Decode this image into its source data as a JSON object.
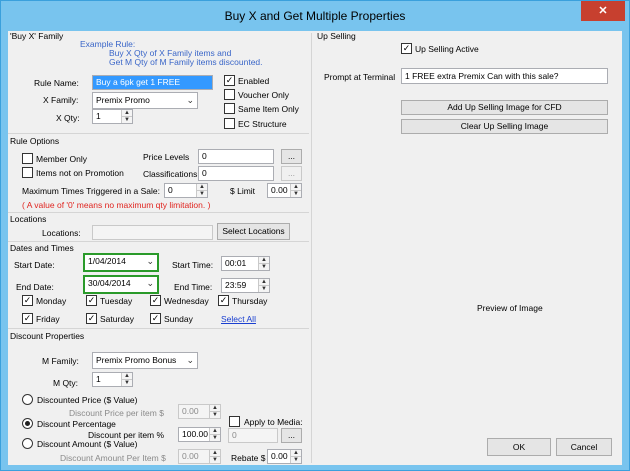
{
  "window": {
    "title": "Buy X and Get Multiple Properties",
    "close_glyph": "✕"
  },
  "buy_x": {
    "group_title": "'Buy X' Family",
    "example_lines": [
      "Example Rule:",
      "Buy X Qty of X Family items and",
      "Get M Qty of M Family items discounted."
    ],
    "rule_name_label": "Rule Name:",
    "rule_name_value": "Buy a 6pk get 1 FREE",
    "x_family_label": "X Family:",
    "x_family_value": "Premix Promo",
    "x_qty_label": "X Qty:",
    "x_qty_value": "1",
    "enabled_label": "Enabled",
    "enabled_checked": true,
    "voucher_label": "Voucher Only",
    "voucher_checked": false,
    "same_item_label": "Same Item Only",
    "same_item_checked": false,
    "ec_label": "EC Structure",
    "ec_checked": false
  },
  "rule_options": {
    "group_title": "Rule Options",
    "member_only_label": "Member Only",
    "member_only_checked": false,
    "items_not_promo_label": "Items not on Promotion",
    "items_not_promo_checked": false,
    "price_levels_label": "Price Levels",
    "price_levels_value": "0",
    "classifications_label": "Classifications",
    "classifications_value": "0",
    "browse_label": "...",
    "max_times_label": "Maximum Times Triggered in a Sale:",
    "max_times_value": "0",
    "limit_label": "$ Limit",
    "limit_value": "0.00",
    "note": "( A value of '0' means no maximum qty limitation. )"
  },
  "locations": {
    "group_title": "Locations",
    "label": "Locations:",
    "value": "",
    "select_button": "Select Locations"
  },
  "dates": {
    "group_title": "Dates and Times",
    "start_date_label": "Start Date:",
    "start_date_value": "1/04/2014",
    "end_date_label": "End Date:",
    "end_date_value": "30/04/2014",
    "start_time_label": "Start Time:",
    "start_time_value": "00:01",
    "end_time_label": "End Time:",
    "end_time_value": "23:59",
    "days": [
      {
        "label": "Monday",
        "checked": true
      },
      {
        "label": "Tuesday",
        "checked": true
      },
      {
        "label": "Wednesday",
        "checked": true
      },
      {
        "label": "Thursday",
        "checked": true
      },
      {
        "label": "Friday",
        "checked": true
      },
      {
        "label": "Saturday",
        "checked": true
      },
      {
        "label": "Sunday",
        "checked": true
      }
    ],
    "select_all": "Select All"
  },
  "discount": {
    "group_title": "Discount Properties",
    "m_family_label": "M Family:",
    "m_family_value": "Premix Promo Bonus",
    "m_qty_label": "M Qty:",
    "m_qty_value": "1",
    "price_radio": "Discounted Price ($ Value)",
    "price_per_item_label": "Discount Price per item $",
    "price_per_item_value": "0.00",
    "pct_radio": "Discount Percentage",
    "pct_per_item_label": "Discount per item %",
    "pct_per_item_value": "100.00",
    "apply_media_label": "Apply to Media:",
    "apply_media_checked": false,
    "apply_media_value": "0",
    "amount_radio": "Discount Amount ($ Value)",
    "amount_per_item_label": "Discount Amount Per Item $",
    "amount_per_item_value": "0.00",
    "rebate_label": "Rebate $",
    "rebate_value": "0.00",
    "selected": "percentage"
  },
  "up_selling": {
    "group_title": "Up Selling",
    "active_label": "Up Selling Active",
    "active_checked": true,
    "prompt_label": "Prompt at Terminal",
    "prompt_value": "1 FREE extra Premix Can with this sale?",
    "add_image_button": "Add Up Selling Image for CFD",
    "clear_image_button": "Clear Up Selling Image",
    "preview_text": "Preview of Image"
  },
  "footer": {
    "ok_label": "OK",
    "cancel_label": "Cancel"
  },
  "glyphs": {
    "check": "✓",
    "chevron": "⌄",
    "spin_up": "▲",
    "spin_down": "▼"
  }
}
